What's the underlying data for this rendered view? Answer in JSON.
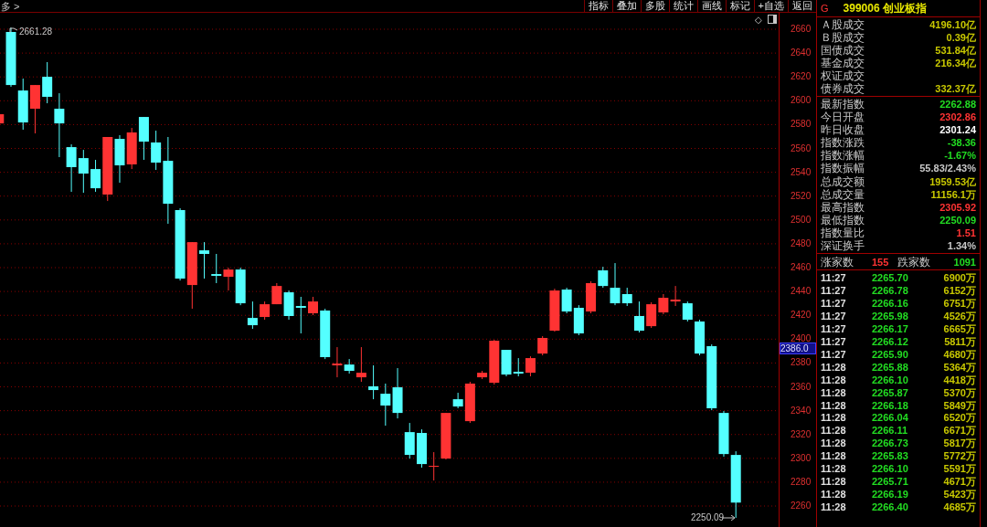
{
  "toolbar": {
    "menu": "多 >",
    "buttons": [
      "指标",
      "叠加",
      "多股",
      "统计",
      "画线",
      "标记",
      "+自选",
      "返回"
    ]
  },
  "chart": {
    "diamond": "◇",
    "chart_data": {
      "type": "candlestick",
      "grid": true,
      "ylim": [
        2242.4,
        2673.8
      ],
      "yticks": [
        2660,
        2640,
        2620,
        2600,
        2580,
        2560,
        2540,
        2520,
        2500,
        2480,
        2460,
        2440,
        2420,
        2400,
        2380,
        2360,
        2340,
        2320,
        2300,
        2280,
        2260
      ],
      "ohlc": [
        [
          2581.0,
          2588.7,
          2581.0,
          2588.7
        ],
        [
          2657.7,
          2661.28,
          2611.7,
          2613.2
        ],
        [
          2608.6,
          2618.6,
          2575.7,
          2581.8
        ],
        [
          2593.3,
          2613.2,
          2572.6,
          2613.2
        ],
        [
          2620.1,
          2632.4,
          2597.9,
          2603.3
        ],
        [
          2593.3,
          2606.3,
          2552.7,
          2581.0
        ],
        [
          2561.1,
          2563.4,
          2523.6,
          2544.3
        ],
        [
          2551.9,
          2558.8,
          2522.8,
          2538.9
        ],
        [
          2542.7,
          2550.4,
          2523.6,
          2526.6
        ],
        [
          2521.3,
          2569.6,
          2515.9,
          2569.6
        ],
        [
          2568.0,
          2571.1,
          2531.2,
          2545.8
        ],
        [
          2546.6,
          2577.2,
          2542.7,
          2573.4
        ],
        [
          2586.4,
          2586.4,
          2550.4,
          2565.7
        ],
        [
          2565.0,
          2574.9,
          2542.0,
          2548.1
        ],
        [
          2549.6,
          2569.6,
          2496.8,
          2513.6
        ],
        [
          2508.3,
          2509.8,
          2449.2,
          2450.8
        ],
        [
          2445.4,
          2481.4,
          2425.5,
          2481.4
        ],
        [
          2474.5,
          2481.4,
          2450.8,
          2471.5
        ],
        [
          2454.6,
          2471.5,
          2447.0,
          2453.1
        ],
        [
          2452.3,
          2460.0,
          2440.8,
          2458.4
        ],
        [
          2458.4,
          2460.0,
          2428.5,
          2430.1
        ],
        [
          2417.8,
          2431.6,
          2408.6,
          2411.7
        ],
        [
          2418.6,
          2431.6,
          2416.3,
          2429.3
        ],
        [
          2429.3,
          2447.0,
          2429.3,
          2444.6
        ],
        [
          2439.3,
          2440.8,
          2416.3,
          2419.4
        ],
        [
          2427.8,
          2435.5,
          2404.8,
          2426.3
        ],
        [
          2421.7,
          2435.5,
          2420.1,
          2431.6
        ],
        [
          2424.0,
          2425.5,
          2383.3,
          2384.9
        ],
        [
          2378.0,
          2393.3,
          2368.0,
          2379.5
        ],
        [
          2378.7,
          2383.3,
          2371.1,
          2373.4
        ],
        [
          2368.0,
          2393.3,
          2364.2,
          2371.8
        ],
        [
          2360.4,
          2378.0,
          2349.6,
          2357.3
        ],
        [
          2354.2,
          2362.7,
          2327.4,
          2344.3
        ],
        [
          2359.6,
          2375.7,
          2333.5,
          2338.1
        ],
        [
          2322.0,
          2329.7,
          2299.8,
          2302.9
        ],
        [
          2321.3,
          2324.3,
          2292.2,
          2295.2
        ],
        [
          2292.9,
          2305.2,
          2281.4,
          2293.7
        ],
        [
          2299.8,
          2338.1,
          2299.1,
          2338.1
        ],
        [
          2349.6,
          2355.0,
          2342.0,
          2343.5
        ],
        [
          2331.2,
          2364.2,
          2329.7,
          2362.7
        ],
        [
          2368.0,
          2373.4,
          2366.5,
          2371.8
        ],
        [
          2363.4,
          2399.4,
          2361.9,
          2398.7
        ],
        [
          2391.0,
          2391.0,
          2368.8,
          2370.3
        ],
        [
          2372.6,
          2384.1,
          2368.8,
          2371.1
        ],
        [
          2371.8,
          2385.6,
          2368.8,
          2384.1
        ],
        [
          2387.9,
          2402.5,
          2386.4,
          2401.0
        ],
        [
          2407.1,
          2442.3,
          2406.3,
          2440.8
        ],
        [
          2441.6,
          2443.1,
          2421.7,
          2423.2
        ],
        [
          2426.3,
          2428.5,
          2403.3,
          2404.8
        ],
        [
          2423.2,
          2448.5,
          2421.7,
          2447.0
        ],
        [
          2457.7,
          2460.7,
          2443.1,
          2444.6
        ],
        [
          2443.1,
          2463.8,
          2428.5,
          2430.1
        ],
        [
          2437.8,
          2443.1,
          2427.8,
          2430.1
        ],
        [
          2419.4,
          2431.6,
          2405.6,
          2407.1
        ],
        [
          2410.9,
          2430.9,
          2409.4,
          2429.3
        ],
        [
          2422.4,
          2437.8,
          2420.9,
          2434.7
        ],
        [
          2431.6,
          2444.6,
          2427.8,
          2433.2
        ],
        [
          2430.1,
          2431.6,
          2414.8,
          2416.3
        ],
        [
          2414.8,
          2416.3,
          2386.4,
          2387.9
        ],
        [
          2394.1,
          2395.6,
          2340.4,
          2342.0
        ],
        [
          2338.1,
          2339.7,
          2301.4,
          2303.6
        ],
        [
          2302.86,
          2305.92,
          2250.09,
          2262.88
        ]
      ]
    },
    "high_label": "2661.28",
    "low_label": "2250.09",
    "cursor_price": "2386.0"
  },
  "quote": {
    "market": "G",
    "code": "399006",
    "name": "创业板指",
    "turnover": [
      {
        "label": "Ａ股成交",
        "value": "4196.10亿"
      },
      {
        "label": "Ｂ股成交",
        "value": "0.39亿"
      },
      {
        "label": "国债成交",
        "value": "531.84亿"
      },
      {
        "label": "基金成交",
        "value": "216.34亿"
      },
      {
        "label": "权证成交"
      },
      {
        "label": "债券成交",
        "value": "332.37亿"
      }
    ],
    "stats": [
      {
        "label": "最新指数",
        "value": "2262.88",
        "color": "#22dd22"
      },
      {
        "label": "今日开盘",
        "value": "2302.86",
        "color": "#ff3333"
      },
      {
        "label": "昨日收盘",
        "value": "2301.24",
        "color": "#ffffff"
      },
      {
        "label": "指数涨跌",
        "value": "-38.36",
        "color": "#22dd22"
      },
      {
        "label": "指数涨幅",
        "value": "-1.67%",
        "color": "#22dd22"
      },
      {
        "label": "指数振幅",
        "value": "55.83/2.43%",
        "color": "#c8c8c8"
      },
      {
        "label": "总成交额",
        "value": "1959.53亿",
        "color": "#c8c800"
      },
      {
        "label": "总成交量",
        "value": "11156.1万",
        "color": "#c8c800"
      },
      {
        "label": "最高指数",
        "value": "2305.92",
        "color": "#ff3333"
      },
      {
        "label": "最低指数",
        "value": "2250.09",
        "color": "#22dd22"
      },
      {
        "label": "指数量比",
        "value": "1.51",
        "color": "#ff3333"
      },
      {
        "label": "深证换手",
        "value": "1.34%",
        "color": "#c8c8c8"
      }
    ],
    "breadth": {
      "up_label": "涨家数",
      "up": "155",
      "down_label": "跌家数",
      "down": "1091"
    },
    "ticks": [
      {
        "time": "11:27",
        "price": "2265.70",
        "volume": "6900万"
      },
      {
        "time": "11:27",
        "price": "2266.78",
        "volume": "6152万"
      },
      {
        "time": "11:27",
        "price": "2266.16",
        "volume": "6751万"
      },
      {
        "time": "11:27",
        "price": "2265.98",
        "volume": "4526万"
      },
      {
        "time": "11:27",
        "price": "2266.17",
        "volume": "6665万"
      },
      {
        "time": "11:27",
        "price": "2266.12",
        "volume": "5811万"
      },
      {
        "time": "11:27",
        "price": "2265.90",
        "volume": "4680万"
      },
      {
        "time": "11:28",
        "price": "2265.88",
        "volume": "5364万"
      },
      {
        "time": "11:28",
        "price": "2266.10",
        "volume": "4418万"
      },
      {
        "time": "11:28",
        "price": "2265.87",
        "volume": "5370万"
      },
      {
        "time": "11:28",
        "price": "2266.18",
        "volume": "5849万"
      },
      {
        "time": "11:28",
        "price": "2266.04",
        "volume": "6520万"
      },
      {
        "time": "11:28",
        "price": "2266.11",
        "volume": "6671万"
      },
      {
        "time": "11:28",
        "price": "2266.73",
        "volume": "5817万"
      },
      {
        "time": "11:28",
        "price": "2265.83",
        "volume": "5772万"
      },
      {
        "time": "11:28",
        "price": "2266.10",
        "volume": "5591万"
      },
      {
        "time": "11:28",
        "price": "2265.71",
        "volume": "4671万"
      },
      {
        "time": "11:28",
        "price": "2266.19",
        "volume": "5423万"
      },
      {
        "time": "11:28",
        "price": "2266.40",
        "volume": "4685万"
      }
    ]
  }
}
